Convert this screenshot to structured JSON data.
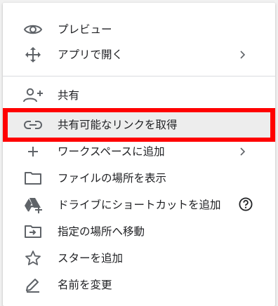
{
  "menu": {
    "items": [
      {
        "label": "プレビュー",
        "icon": "eye-icon"
      },
      {
        "label": "アプリで開く",
        "icon": "move-arrows-icon",
        "has_submenu": true
      },
      {
        "label": "共有",
        "icon": "person-add-icon"
      },
      {
        "label": "共有可能なリンクを取得",
        "icon": "link-icon",
        "highlighted": true
      },
      {
        "label": "ワークスペースに追加",
        "icon": "plus-icon",
        "has_submenu": true
      },
      {
        "label": "ファイルの場所を表示",
        "icon": "folder-icon"
      },
      {
        "label": "ドライブにショートカットを追加",
        "icon": "drive-add-icon",
        "help": true
      },
      {
        "label": "指定の場所へ移動",
        "icon": "folder-move-icon"
      },
      {
        "label": "スターを追加",
        "icon": "star-icon"
      },
      {
        "label": "名前を変更",
        "icon": "pencil-icon"
      }
    ]
  },
  "colors": {
    "text": "#202124",
    "icon": "#5f6368",
    "highlight_border": "#ff0000",
    "highlight_fill": "#ededed",
    "divider": "#dadce0"
  }
}
